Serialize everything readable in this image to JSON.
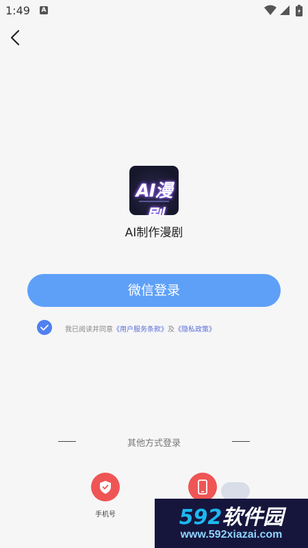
{
  "status_bar": {
    "time": "1:49",
    "notification_icon": "a-box-icon",
    "icons": [
      "wifi-icon",
      "signal-icon",
      "battery-icon"
    ]
  },
  "nav": {
    "back_icon": "chevron-left-icon"
  },
  "app": {
    "logo_text": "AI漫剧",
    "name": "AI制作漫剧"
  },
  "login": {
    "wechat_label": "微信登录",
    "agreement": {
      "checked": true,
      "prefix": "我已阅读并同意",
      "terms_link": "《用户服务条款》",
      "connector": "及",
      "privacy_link": "《隐私政策》"
    }
  },
  "other": {
    "label": "其他方式登录",
    "methods": [
      {
        "icon": "shield-icon",
        "label": "手机号"
      },
      {
        "icon": "phone-device-icon",
        "label": ""
      }
    ]
  },
  "watermark": {
    "brand_num": "592",
    "brand_text": "软件园",
    "url": "www.592xiazai.com"
  },
  "colors": {
    "primary_button": "#5ea0f8",
    "checkbox": "#5080f0",
    "link": "#5a6fd8",
    "alt_login": "#ef5555",
    "background": "#f6f6f7"
  }
}
